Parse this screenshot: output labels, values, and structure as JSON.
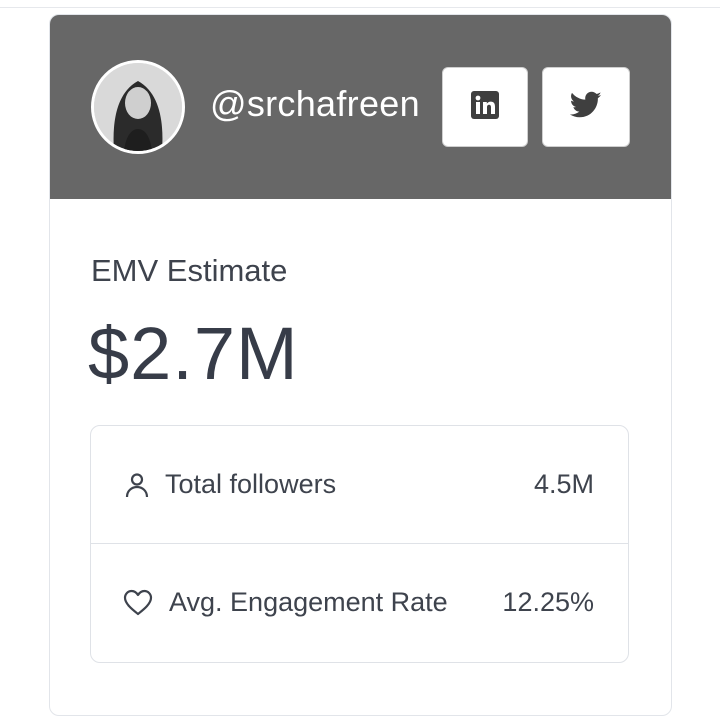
{
  "profile": {
    "handle": "@srchafreen",
    "avatar_icon": "profile-photo",
    "header_color": "#676767"
  },
  "social": [
    {
      "name": "LinkedIn",
      "icon": "linkedin-icon"
    },
    {
      "name": "Twitter",
      "icon": "twitter-icon"
    }
  ],
  "emv": {
    "label": "EMV Estimate",
    "value": "$2.7M"
  },
  "stats": [
    {
      "icon": "user-icon",
      "label": "Total followers",
      "value": "4.5M"
    },
    {
      "icon": "heart-icon",
      "label": "Avg. Engagement Rate",
      "value": "12.25%"
    }
  ]
}
